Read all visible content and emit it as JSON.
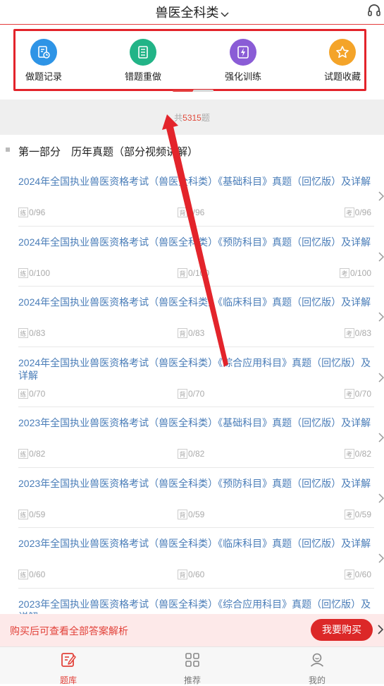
{
  "header": {
    "title": "兽医全科类"
  },
  "quick_actions": [
    {
      "label": "做题记录",
      "icon": "record-icon",
      "color": "#2e94e6"
    },
    {
      "label": "错题重做",
      "icon": "wrong-list-icon",
      "color": "#22b487"
    },
    {
      "label": "强化训练",
      "icon": "lightning-icon",
      "color": "#8a5cd6"
    },
    {
      "label": "试题收藏",
      "icon": "star-icon",
      "color": "#f4a429"
    }
  ],
  "count": {
    "prefix": "共",
    "value": "5315",
    "suffix": "题"
  },
  "section": {
    "title": "第一部分　历年真题（部分视频讲解）"
  },
  "tags": {
    "practice": "练",
    "memorize": "背",
    "exam": "考"
  },
  "items": [
    {
      "title": "2024年全国执业兽医资格考试（兽医全科类）《基础科目》真题（回忆版）及详解",
      "practice": "0/96",
      "memorize": "0/96",
      "exam": "0/96"
    },
    {
      "title": "2024年全国执业兽医资格考试（兽医全科类）《预防科目》真题（回忆版）及详解",
      "practice": "0/100",
      "memorize": "0/100",
      "exam": "0/100"
    },
    {
      "title": "2024年全国执业兽医资格考试（兽医全科类）《临床科目》真题（回忆版）及详解",
      "practice": "0/83",
      "memorize": "0/83",
      "exam": "0/83"
    },
    {
      "title": "2024年全国执业兽医资格考试（兽医全科类）《综合应用科目》真题（回忆版）及详解",
      "practice": "0/70",
      "memorize": "0/70",
      "exam": "0/70"
    },
    {
      "title": "2023年全国执业兽医资格考试（兽医全科类）《基础科目》真题（回忆版）及详解",
      "practice": "0/82",
      "memorize": "0/82",
      "exam": "0/82"
    },
    {
      "title": "2023年全国执业兽医资格考试（兽医全科类）《预防科目》真题（回忆版）及详解",
      "practice": "0/59",
      "memorize": "0/59",
      "exam": "0/59"
    },
    {
      "title": "2023年全国执业兽医资格考试（兽医全科类）《临床科目》真题（回忆版）及详解",
      "practice": "0/60",
      "memorize": "0/60",
      "exam": "0/60"
    },
    {
      "title": "2023年全国执业兽医资格考试（兽医全科类）《综合应用科目》真题（回忆版）及详解",
      "practice": "",
      "memorize": "",
      "exam": ""
    }
  ],
  "buy_banner": {
    "text": "购买后可查看全部答案解析",
    "button": "我要购买"
  },
  "bottom_nav": [
    {
      "label": "题库",
      "icon": "question-bank-icon",
      "active": true
    },
    {
      "label": "推荐",
      "icon": "grid-icon",
      "active": false
    },
    {
      "label": "我的",
      "icon": "profile-icon",
      "active": false
    }
  ],
  "colors": {
    "accent": "#e2423a",
    "link": "#4a7db8",
    "highlight_frame": "#e3242b"
  }
}
